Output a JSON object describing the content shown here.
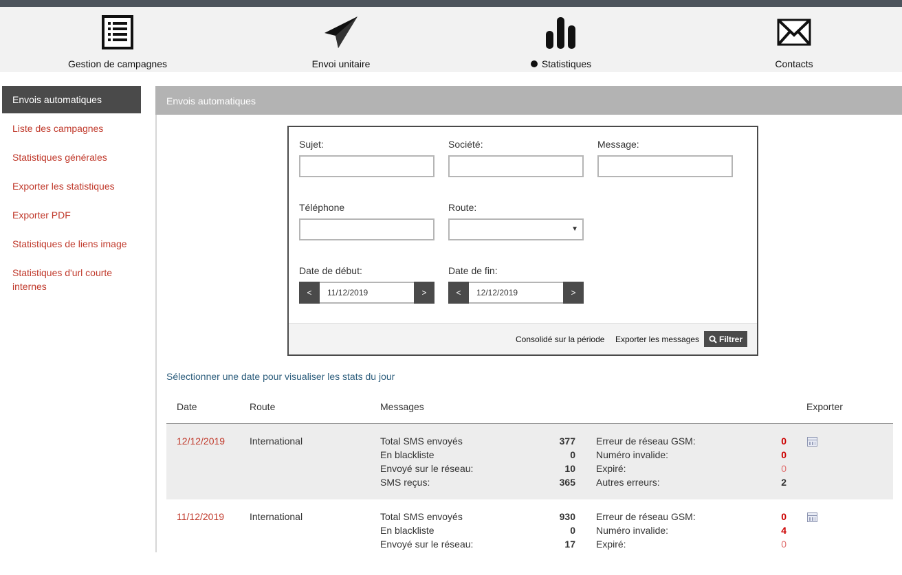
{
  "topnav": {
    "items": [
      {
        "label": "Gestion de campagnes",
        "icon": "list-icon"
      },
      {
        "label": "Envoi unitaire",
        "icon": "paper-plane-icon"
      },
      {
        "label": "Statistiques",
        "icon": "bar-chart-icon",
        "active": true
      },
      {
        "label": "Contacts",
        "icon": "envelope-icon"
      }
    ]
  },
  "sidebar": {
    "active": "Envois automatiques",
    "items": [
      "Liste des campagnes",
      "Statistiques générales",
      "Exporter les statistiques",
      "Exporter PDF",
      "Statistiques de liens image",
      "Statistiques d'url courte internes"
    ]
  },
  "main": {
    "title": "Envois automatiques"
  },
  "filter": {
    "subject_label": "Sujet:",
    "company_label": "Société:",
    "message_label": "Message:",
    "phone_label": "Téléphone",
    "route_label": "Route:",
    "start_label": "Date de début:",
    "end_label": "Date de fin:",
    "start_value": "11/12/2019",
    "end_value": "12/12/2019",
    "prev": "<",
    "next": ">",
    "consolidated_link": "Consolidé sur la période",
    "export_messages_link": "Exporter les messages",
    "filter_button": "Filtrer"
  },
  "hint": "Sélectionner une date pour visualiser les stats du jour",
  "table": {
    "headers": {
      "date": "Date",
      "route": "Route",
      "messages": "Messages",
      "export": "Exporter"
    },
    "rows": [
      {
        "date": "12/12/2019",
        "route": "International",
        "stats": [
          {
            "label": "Total SMS envoyés",
            "value": "377"
          },
          {
            "label": "En blackliste",
            "value": "0"
          },
          {
            "label": "Envoyé sur le réseau:",
            "value": "10"
          },
          {
            "label": "SMS reçus:",
            "value": "365"
          }
        ],
        "errors": [
          {
            "label": "Erreur de réseau GSM:",
            "value": "0",
            "style": "red"
          },
          {
            "label": "Numéro invalide:",
            "value": "0",
            "style": "red"
          },
          {
            "label": "Expiré:",
            "value": "0",
            "style": "pink"
          },
          {
            "label": "Autres erreurs:",
            "value": "2",
            "style": "plain"
          }
        ]
      },
      {
        "date": "11/12/2019",
        "route": "International",
        "stats": [
          {
            "label": "Total SMS envoyés",
            "value": "930"
          },
          {
            "label": "En blackliste",
            "value": "0"
          },
          {
            "label": "Envoyé sur le réseau:",
            "value": "17"
          }
        ],
        "errors": [
          {
            "label": "Erreur de réseau GSM:",
            "value": "0",
            "style": "red"
          },
          {
            "label": "Numéro invalide:",
            "value": "4",
            "style": "red"
          },
          {
            "label": "Expiré:",
            "value": "0",
            "style": "pink"
          }
        ]
      }
    ]
  }
}
